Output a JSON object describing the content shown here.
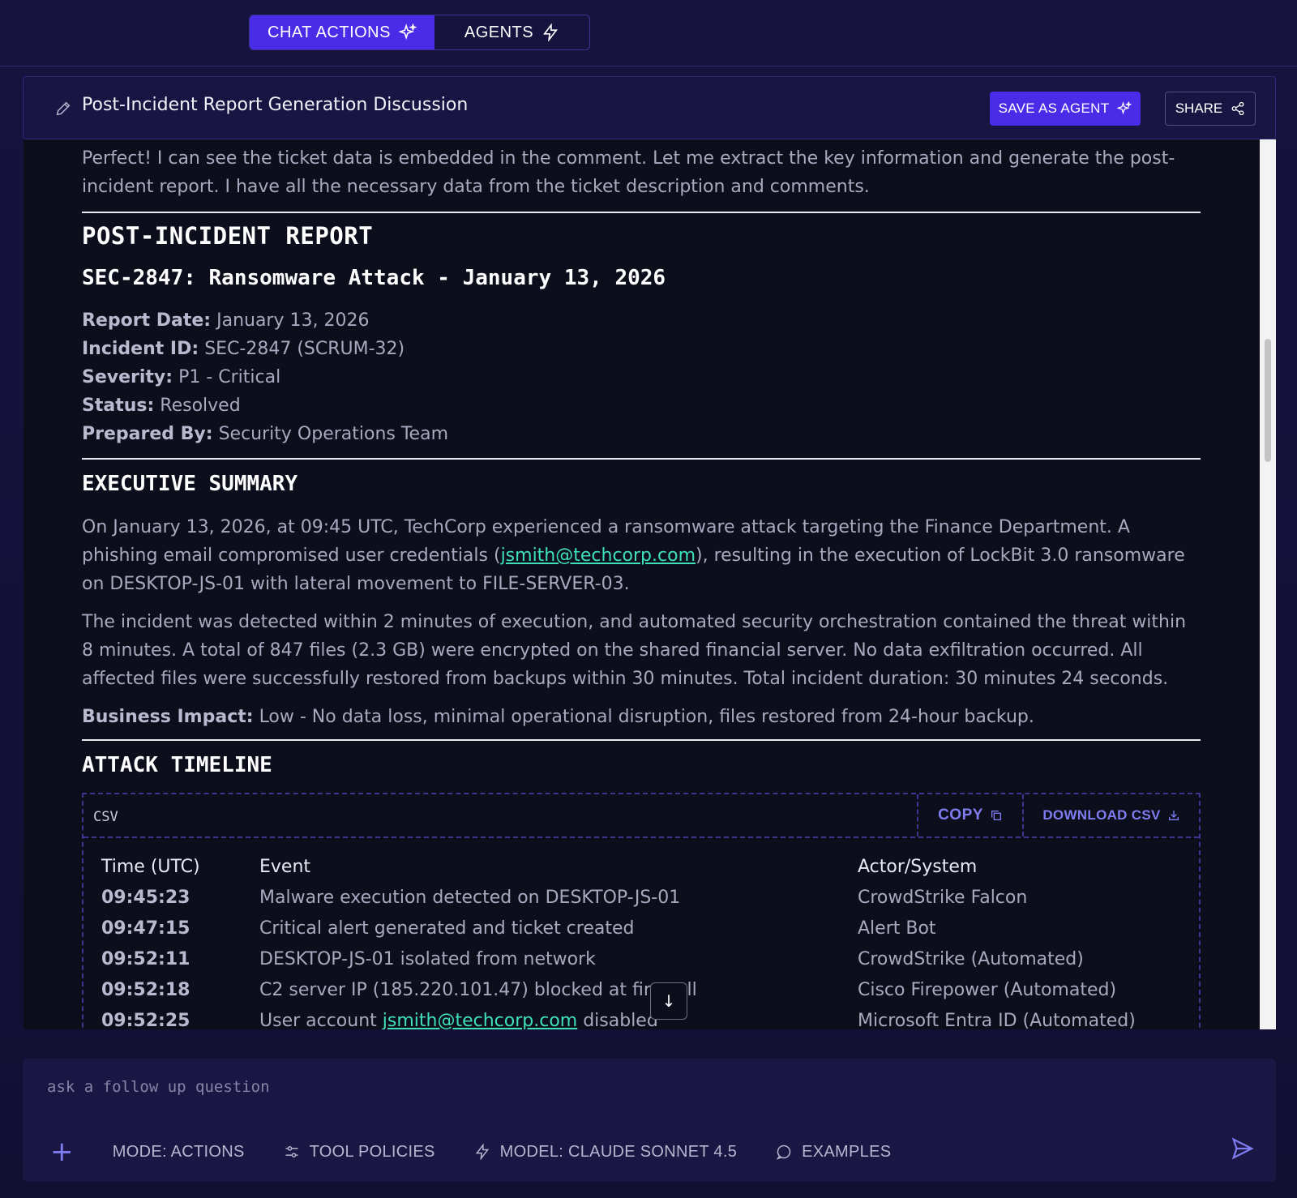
{
  "nav": {
    "tabs": [
      {
        "label": "CHAT ACTIONS",
        "icon": "sparkle-icon",
        "active": true
      },
      {
        "label": "AGENTS",
        "icon": "lightning-icon",
        "active": false
      }
    ]
  },
  "header": {
    "title": "Post-Incident Report Generation Discussion",
    "save_label": "SAVE AS AGENT",
    "share_label": "SHARE"
  },
  "message": {
    "intro": "Perfect! I can see the ticket data is embedded in the comment. Let me extract the key information and generate the post-incident report. I have all the necessary data from the ticket description and comments.",
    "report_title": "POST-INCIDENT REPORT",
    "report_subtitle": "SEC-2847: Ransomware Attack - January 13, 2026",
    "meta": [
      {
        "label": "Report Date:",
        "value": "January 13, 2026"
      },
      {
        "label": "Incident ID:",
        "value": "SEC-2847 (SCRUM-32)"
      },
      {
        "label": "Severity:",
        "value": "P1 - Critical"
      },
      {
        "label": "Status:",
        "value": "Resolved"
      },
      {
        "label": "Prepared By:",
        "value": "Security Operations Team"
      }
    ],
    "exec_heading": "EXECUTIVE SUMMARY",
    "exec_p1_a": "On January 13, 2026, at 09:45 UTC, TechCorp experienced a ransomware attack targeting the Finance Department. A phishing email compromised user credentials (",
    "exec_p1_link": "jsmith@techcorp.com",
    "exec_p1_b": "), resulting in the execution of LockBit 3.0 ransomware on DESKTOP-JS-01 with lateral movement to FILE-SERVER-03.",
    "exec_p2": "The incident was detected within 2 minutes of execution, and automated security orchestration contained the threat within 8 minutes. A total of 847 files (2.3 GB) were encrypted on the shared financial server. No data exfiltration occurred. All affected files were successfully restored from backups within 30 minutes. Total incident duration: 30 minutes 24 seconds.",
    "impact_label": "Business Impact:",
    "impact_value": "Low - No data loss, minimal operational disruption, files restored from 24-hour backup.",
    "timeline_heading": "ATTACK TIMELINE"
  },
  "csv": {
    "label": "CSV",
    "copy_label": "COPY",
    "download_label": "DOWNLOAD CSV",
    "headers": [
      "Time (UTC)",
      "Event",
      "Actor/System"
    ],
    "rows": [
      {
        "time": "09:45:23",
        "event": "Malware execution detected on DESKTOP-JS-01",
        "actor": "CrowdStrike Falcon"
      },
      {
        "time": "09:47:15",
        "event": "Critical alert generated and ticket created",
        "actor": "Alert Bot"
      },
      {
        "time": "09:52:11",
        "event": "DESKTOP-JS-01 isolated from network",
        "actor": "CrowdStrike (Automated)"
      },
      {
        "time": "09:52:18",
        "event": "C2 server IP (185.220.101.47) blocked at firewall",
        "actor": "Cisco Firepower (Automated)"
      },
      {
        "time": "09:52:25",
        "event_a": "User account ",
        "event_link": "jsmith@techcorp.com",
        "event_b": " disabled",
        "actor": "Microsoft Entra ID (Automated)"
      }
    ]
  },
  "composer": {
    "placeholder": "ask a follow up question",
    "mode_label": "MODE: ACTIONS",
    "tool_policies_label": "TOOL POLICIES",
    "model_label": "MODEL: CLAUDE SONNET 4.5",
    "examples_label": "EXAMPLES"
  },
  "colors": {
    "accent": "#4a2be8",
    "link": "#3ee0b8",
    "background": "#15123a",
    "content": "#0d0e1c"
  }
}
